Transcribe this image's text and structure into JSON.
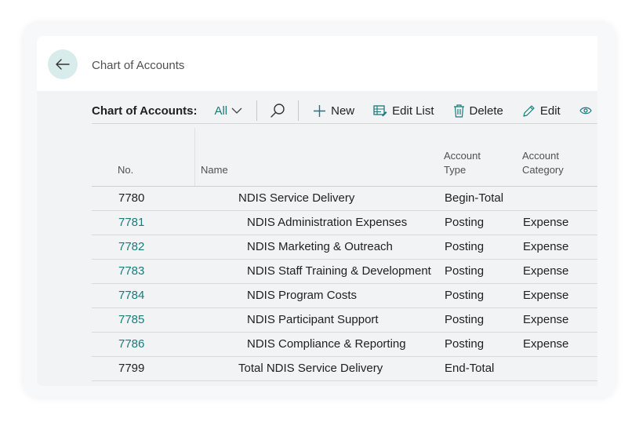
{
  "header": {
    "title": "Chart of Accounts"
  },
  "action_bar": {
    "caption": "Chart of Accounts:",
    "filter": "All",
    "actions": {
      "new": "New",
      "edit_list": "Edit List",
      "delete": "Delete",
      "edit": "Edit"
    }
  },
  "colors": {
    "accent": "#1a7a7a",
    "back_button_bg": "#d8ecec"
  },
  "table": {
    "columns": {
      "no": "No.",
      "name": "Name",
      "type_line1": "Account",
      "type_line2": "Type",
      "category_line1": "Account",
      "category_line2": "Category"
    },
    "rows": [
      {
        "no": "7780",
        "name": "NDIS Service Delivery",
        "type": "Begin-Total",
        "category": ""
      },
      {
        "no": "7781",
        "name": "NDIS Administration Expenses",
        "type": "Posting",
        "category": "Expense"
      },
      {
        "no": "7782",
        "name": "NDIS Marketing & Outreach",
        "type": "Posting",
        "category": "Expense"
      },
      {
        "no": "7783",
        "name": "NDIS Staff Training & Development",
        "type": "Posting",
        "category": "Expense"
      },
      {
        "no": "7784",
        "name": "NDIS Program Costs",
        "type": "Posting",
        "category": "Expense"
      },
      {
        "no": "7785",
        "name": "NDIS Participant Support",
        "type": "Posting",
        "category": "Expense"
      },
      {
        "no": "7786",
        "name": "NDIS Compliance & Reporting",
        "type": "Posting",
        "category": "Expense"
      },
      {
        "no": "7799",
        "name": "Total NDIS Service Delivery",
        "type": "End-Total",
        "category": ""
      }
    ]
  }
}
